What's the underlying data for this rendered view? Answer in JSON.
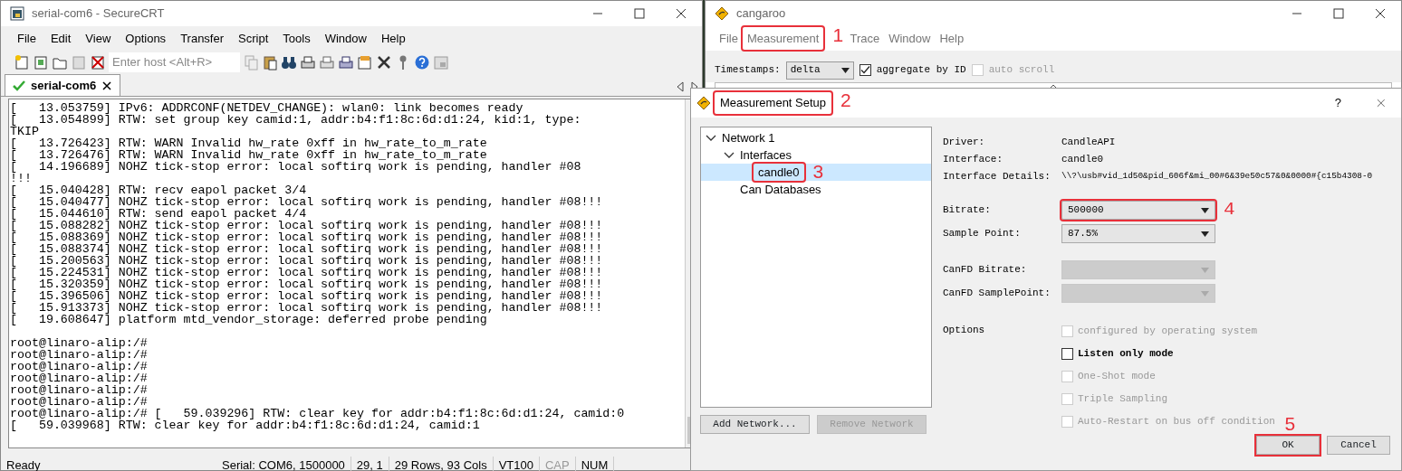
{
  "securecrt": {
    "title": "serial-com6 - SecureCRT",
    "menu": [
      "File",
      "Edit",
      "View",
      "Options",
      "Transfer",
      "Script",
      "Tools",
      "Window",
      "Help"
    ],
    "host_field": {
      "placeholder": "Enter host <Alt+R>"
    },
    "tab": {
      "label": "serial-com6",
      "connected": true
    },
    "terminal_blocks": [
      [
        "[   13.053759] IPv6: ADDRCONF(NETDEV_CHANGE): wlan0: link becomes ready",
        "[   13.054899] RTW: set group key camid:1, addr:b4:f1:8c:6d:d1:24, kid:1, type:",
        "TKIP",
        "[   13.726423] RTW: WARN Invalid hw_rate 0xff in hw_rate_to_m_rate",
        "[   13.726476] RTW: WARN Invalid hw_rate 0xff in hw_rate_to_m_rate",
        "[   14.196689] NOHZ tick-stop error: local softirq work is pending, handler #08",
        "!!!",
        "[   15.040428] RTW: recv eapol packet 3/4",
        "[   15.040477] NOHZ tick-stop error: local softirq work is pending, handler #08!!!",
        "[   15.044610] RTW: send eapol packet 4/4",
        "[   15.088282] NOHZ tick-stop error: local softirq work is pending, handler #08!!!",
        "[   15.088369] NOHZ tick-stop error: local softirq work is pending, handler #08!!!",
        "[   15.088374] NOHZ tick-stop error: local softirq work is pending, handler #08!!!",
        "[   15.200563] NOHZ tick-stop error: local softirq work is pending, handler #08!!!",
        "[   15.224531] NOHZ tick-stop error: local softirq work is pending, handler #08!!!",
        "[   15.320359] NOHZ tick-stop error: local softirq work is pending, handler #08!!!",
        "[   15.396506] NOHZ tick-stop error: local softirq work is pending, handler #08!!!",
        "[   15.913373] NOHZ tick-stop error: local softirq work is pending, handler #08!!!",
        "[   19.608647] platform mtd_vendor_storage: deferred probe pending"
      ],
      [
        "root@linaro-alip:/#",
        "root@linaro-alip:/#",
        "root@linaro-alip:/#",
        "root@linaro-alip:/#",
        "root@linaro-alip:/#",
        "root@linaro-alip:/#",
        "root@linaro-alip:/# [   59.039296] RTW: clear key for addr:b4:f1:8c:6d:d1:24, camid:0",
        "[   59.039968] RTW: clear key for addr:b4:f1:8c:6d:d1:24, camid:1"
      ]
    ],
    "status_bar": [
      {
        "text": "Ready",
        "disabled": false
      },
      {
        "text": "Serial: COM6, 1500000",
        "disabled": false
      },
      {
        "text": "29,   1",
        "disabled": false
      },
      {
        "text": "29 Rows, 93 Cols",
        "disabled": false
      },
      {
        "text": "VT100",
        "disabled": false
      },
      {
        "text": "CAP",
        "disabled": true
      },
      {
        "text": "NUM",
        "disabled": false
      }
    ]
  },
  "cangaroo": {
    "title": "cangaroo",
    "menu": [
      {
        "label": "File"
      },
      {
        "label": "Measurement",
        "callout": "1"
      },
      {
        "label": "Trace"
      },
      {
        "label": "Window"
      },
      {
        "label": "Help"
      }
    ],
    "timestamps": {
      "label": "Timestamps:",
      "value": "delta"
    },
    "checks": [
      {
        "label": "aggregate by ID",
        "checked": true,
        "disabled": false
      },
      {
        "label": "auto scroll",
        "checked": false,
        "disabled": true
      }
    ]
  },
  "dialog": {
    "title": "Measurement Setup",
    "callout": "2",
    "help": "?",
    "tree": [
      {
        "label": "Network 1",
        "expanded": true,
        "selected": false,
        "children": [
          {
            "label": "Interfaces",
            "expanded": true,
            "selected": false,
            "children": [
              {
                "label": "candle0",
                "selected": true,
                "callout": "3"
              }
            ]
          },
          {
            "label": "Can Databases",
            "selected": false
          }
        ]
      }
    ],
    "network_buttons": [
      {
        "label": "Add Network...",
        "disabled": false
      },
      {
        "label": "Remove Network",
        "disabled": true
      }
    ],
    "details": [
      {
        "label": "Driver:",
        "value": "CandleAPI"
      },
      {
        "label": "Interface:",
        "value": "candle0"
      },
      {
        "label": "Interface Details:",
        "value": "\\\\?\\usb#vid_1d50&pid_606f&mi_00#6&39e50c57&0&0000#{c15b4308-0"
      }
    ],
    "selects": [
      {
        "label": "Bitrate:",
        "value": "500000",
        "disabled": false,
        "callout": "4"
      },
      {
        "label": "Sample Point:",
        "value": "87.5%",
        "disabled": false
      },
      {
        "label": "CanFD Bitrate:",
        "disabled": true
      },
      {
        "label": "CanFD SamplePoint:",
        "disabled": true
      }
    ],
    "options_label": "Options",
    "options": [
      {
        "label": "configured by operating system",
        "checked": false,
        "disabled": true
      },
      {
        "label": "Listen only mode",
        "checked": false,
        "disabled": false
      },
      {
        "label": "One-Shot mode",
        "checked": false,
        "disabled": true
      },
      {
        "label": "Triple Sampling",
        "checked": false,
        "disabled": true
      },
      {
        "label": "Auto-Restart on bus off condition",
        "checked": false,
        "disabled": true
      }
    ],
    "footer_buttons": [
      {
        "label": "OK",
        "callout": "5"
      },
      {
        "label": "Cancel"
      }
    ]
  }
}
